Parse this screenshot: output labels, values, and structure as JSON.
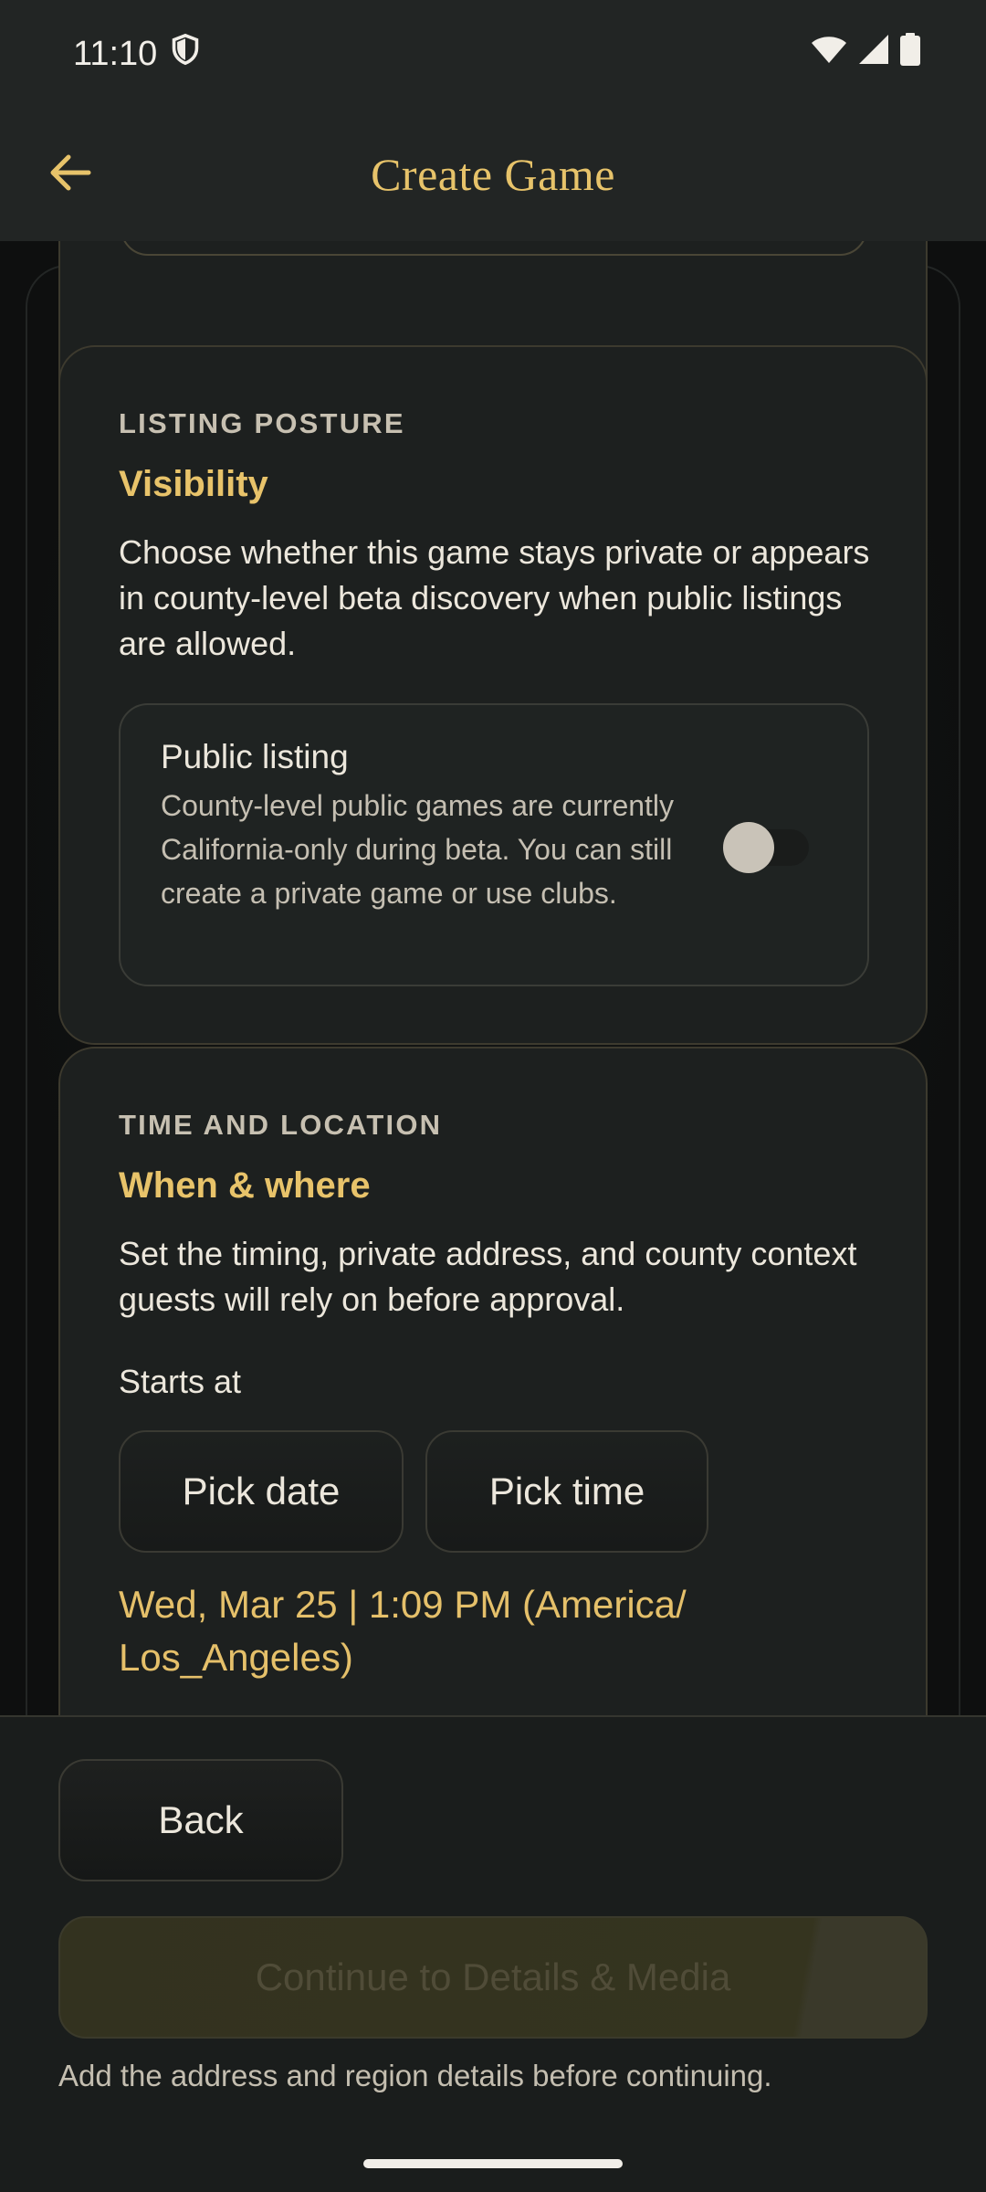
{
  "status_bar": {
    "time": "11:10",
    "icons": [
      "shield-icon",
      "wifi-icon",
      "signal-icon",
      "battery-icon"
    ]
  },
  "app_bar": {
    "title": "Create Game",
    "back_icon": "arrow-left-icon"
  },
  "visibility_card": {
    "eyebrow": "LISTING POSTURE",
    "title": "Visibility",
    "description": "Choose whether this game stays private or appears in county-level beta discovery when public listings are allowed.",
    "option": {
      "title": "Public listing",
      "subtitle": "County-level public games are currently California-only during beta. You can still create a private game or use clubs.",
      "enabled": false
    }
  },
  "time_card": {
    "eyebrow": "TIME AND LOCATION",
    "title": "When & where",
    "description": "Set the timing, private address, and county context guests will rely on before approval.",
    "starts_label": "Starts at",
    "pick_date_label": "Pick date",
    "pick_time_label": "Pick time",
    "selected_datetime": "Wed, Mar 25 | 1:09 PM (America/ Los_Angeles)"
  },
  "footer": {
    "back_label": "Back",
    "continue_label": "Continue to Details & Media",
    "helper_text": "Add the address and region details before continuing."
  },
  "colors": {
    "accent": "#e7c36a",
    "background": "#151716",
    "card": "#1d201f",
    "bar": "#222524"
  }
}
